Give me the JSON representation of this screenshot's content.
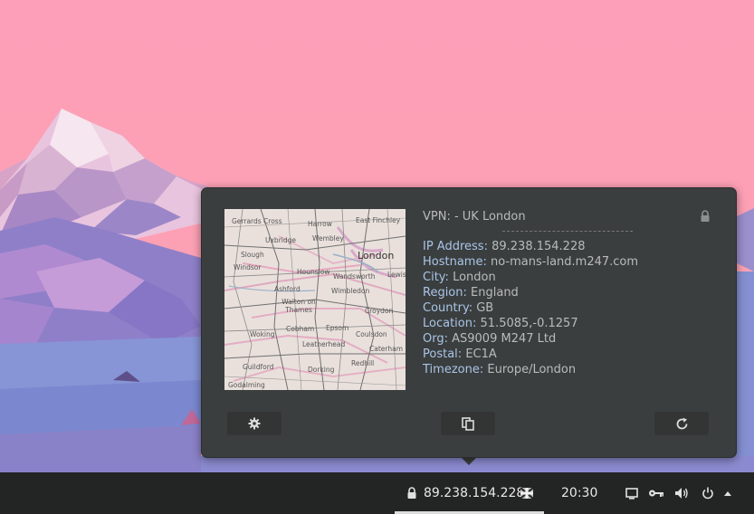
{
  "vpn": {
    "title": "VPN: - UK London",
    "fields": [
      {
        "key": "IP Address:",
        "value": "89.238.154.228"
      },
      {
        "key": "Hostname:",
        "value": "no-mans-land.m247.com"
      },
      {
        "key": "City:",
        "value": "London"
      },
      {
        "key": "Region:",
        "value": "England"
      },
      {
        "key": "Country:",
        "value": "GB"
      },
      {
        "key": "Location:",
        "value": "51.5085,-0.1257"
      },
      {
        "key": "Org:",
        "value": "AS9009 M247 Ltd"
      },
      {
        "key": "Postal:",
        "value": "EC1A"
      },
      {
        "key": "Timezone:",
        "value": "Europe/London"
      }
    ]
  },
  "map": {
    "labels": [
      "Gerrards Cross",
      "Harrow",
      "East Finchley",
      "Uxbridge",
      "Wembley",
      "London",
      "Slough",
      "Windsor",
      "Hounslow",
      "Wandsworth",
      "Lewis",
      "Ashford",
      "Wimbledon",
      "Walton on Thames",
      "Croydon",
      "Cobham",
      "Epsom",
      "Coulsdon",
      "Woking",
      "Leatherhead",
      "Caterham",
      "Redhill",
      "Guildford",
      "Dorking",
      "Godalming"
    ]
  },
  "buttons": {
    "settings": "gear-icon",
    "copy": "copy-icon",
    "refresh": "refresh-icon"
  },
  "taskbar": {
    "ip": "89.238.154.228",
    "time": "20:30",
    "icons": [
      "lock-icon",
      "uk-flag-icon",
      "display-icon",
      "key-icon",
      "volume-icon",
      "power-icon",
      "menu-arrow-icon"
    ]
  },
  "colors": {
    "popup_bg": "#3b3e3e",
    "key_text": "#a8c5e8",
    "value_text": "#b9bcbc",
    "taskbar_bg": "#232424"
  }
}
